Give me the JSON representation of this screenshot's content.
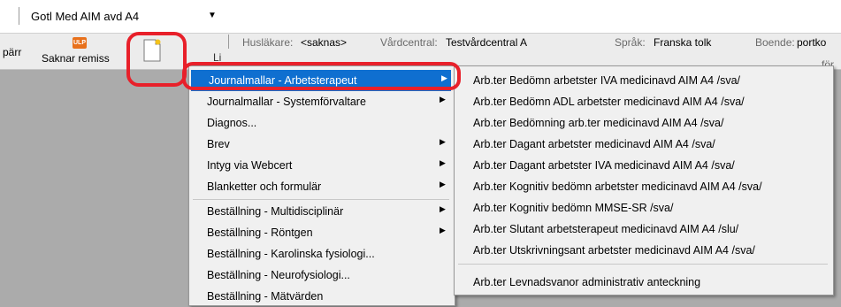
{
  "unit_selector": {
    "value": "Gotl Med AIM avd A4"
  },
  "toolbar": {
    "left_partial": "pärr",
    "missing_referral": "Saknar remiss",
    "ulp_badge": "ULP",
    "partial_label": "Li"
  },
  "infobar": {
    "physician_label": "Husläkare:",
    "physician_value": "<saknas>",
    "center_label": "Vårdcentral:",
    "center_value": "Testvårdcentral A",
    "language_label": "Språk:",
    "language_value": "Franska tolk",
    "housing_label": "Boende:",
    "housing_value": "portko",
    "partial_right": "för"
  },
  "context_menu": {
    "items": [
      {
        "label": "Journalmallar - Arbetsterapeut",
        "submenu": true,
        "selected": true
      },
      {
        "label": "Journalmallar - Systemförvaltare",
        "submenu": true
      },
      {
        "label": "Diagnos...",
        "submenu": false
      },
      {
        "label": "Brev",
        "submenu": true
      },
      {
        "label": "Intyg via Webcert",
        "submenu": true
      },
      {
        "label": "Blanketter och formulär",
        "submenu": true
      },
      {
        "label": "Beställning - Multidisciplinär",
        "submenu": true
      },
      {
        "label": "Beställning - Röntgen",
        "submenu": true
      },
      {
        "label": "Beställning - Karolinska fysiologi...",
        "submenu": false
      },
      {
        "label": "Beställning - Neurofysiologi...",
        "submenu": false
      },
      {
        "label": "Beställning - Mätvärden",
        "submenu": false
      }
    ]
  },
  "submenu": {
    "items": [
      "Arb.ter Bedömn arbetster IVA medicinavd AIM A4 /sva/",
      "Arb.ter Bedömn ADL arbetster medicinavd AIM A4 /sva/",
      "Arb.ter Bedömning arb.ter medicinavd AIM A4 /sva/",
      "Arb.ter Dagant arbetster medicinavd AIM A4 /sva/",
      "Arb.ter Dagant arbetster IVA medicinavd AIM A4 /sva/",
      "Arb.ter Kognitiv bedömn arbetster medicinavd AIM A4 /sva/",
      "Arb.ter Kognitiv bedömn MMSE-SR /sva/",
      "Arb.ter Slutant arbetsterapeut medicinavd AIM A4 /slu/",
      "Arb.ter Utskrivningsant arbetster medicinavd AIM A4 /sva/",
      "Arb.ter Levnadsvanor administrativ anteckning"
    ]
  },
  "icons": {
    "submenu_arrow": "chevron-right-icon",
    "dropdown_arrow": "caret-down-icon",
    "new_document": "new-document-icon"
  },
  "colors": {
    "selection": "#0f6fd0",
    "highlight_ring": "#e8202a",
    "ulp_badge": "#e8711c"
  }
}
